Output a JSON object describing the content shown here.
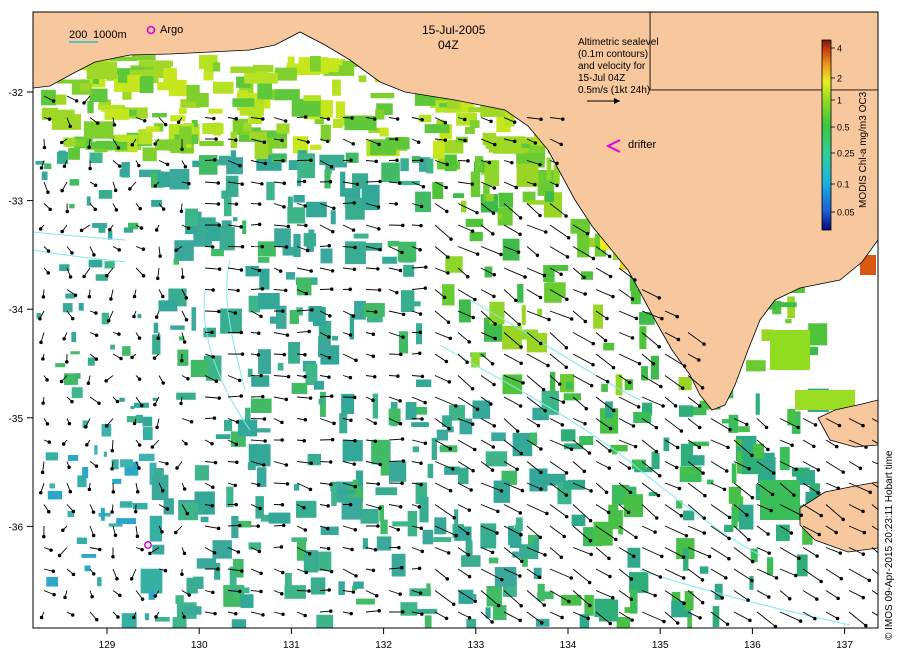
{
  "map": {
    "date": "15-Jul-2005",
    "time": "04Z",
    "scale_bar_label": "200",
    "isobath_label": "1000m",
    "argo_label": "Argo",
    "drifter_label": "drifter",
    "velocity_note": {
      "line1": "Altimetric sealevel",
      "line2": "(0.1m contours)",
      "line3": "and velocity for",
      "line4": "15-Jul 04Z",
      "line5": "0.5m/s (1kt 24h)"
    },
    "credit": "© IMOS 09-Apr-2015 20:23:11 Hobart time",
    "x_axis": {
      "ticks": [
        "129",
        "130",
        "131",
        "132",
        "133",
        "134",
        "135",
        "136",
        "137"
      ]
    },
    "y_axis": {
      "ticks": [
        "-32",
        "-33",
        "-34",
        "-35",
        "-36"
      ]
    }
  },
  "colorbar": {
    "label": "MODIS Chl-a mg/m3 OC3",
    "ticks": [
      "4",
      "2",
      "1",
      "0.5",
      "0.25",
      "0.1",
      "0.05"
    ],
    "colors": [
      "#08087a",
      "#1d5fd6",
      "#19b4e0",
      "#2fcf9a",
      "#3bc640",
      "#8fdc20",
      "#e6ee20",
      "#f0a020",
      "#cf4a10",
      "#7a1808"
    ]
  },
  "colors": {
    "land": "#f7c79e",
    "ocean_nodata": "#ffffff",
    "chlorophyll_low": "#3aa79a",
    "chlorophyll_mid": "#3cc24a",
    "chlorophyll_high": "#c8e420",
    "argo": "#d400d4",
    "drifter": "#e000e0",
    "contour": "#5ae0e8"
  }
}
